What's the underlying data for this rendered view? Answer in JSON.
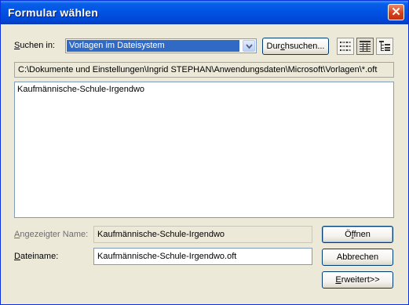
{
  "window": {
    "title": "Formular wählen",
    "close_glyph": "✕"
  },
  "search": {
    "label": "Suchen in:",
    "label_underlined_char": "S",
    "label_rest": "uchen in:",
    "selected": "Vorlagen im Dateisystem",
    "browse_label": "Durchsuchen...",
    "browse_pre": "Dur",
    "browse_underlined_char": "c",
    "browse_post": "hsuchen..."
  },
  "view_buttons": [
    {
      "icon": "list-view-icon",
      "active": false
    },
    {
      "icon": "details-view-icon",
      "active": true
    },
    {
      "icon": "tree-view-icon",
      "active": false
    }
  ],
  "path": "C:\\Dokumente und Einstellungen\\Ingrid STEPHAN\\Anwendungsdaten\\Microsoft\\Vorlagen\\*.oft",
  "list": {
    "items": [
      "Kaufmännische-Schule-Irgendwo"
    ]
  },
  "display_name": {
    "label": "Angezeigter Name:",
    "label_underlined_char": "A",
    "label_rest": "ngezeigter Name:",
    "value": "Kaufmännische-Schule-Irgendwo"
  },
  "file_name": {
    "label": "Dateiname:",
    "label_underlined_char": "D",
    "label_rest": "ateiname:",
    "value": "Kaufmännische-Schule-Irgendwo.oft"
  },
  "buttons": {
    "open": "Öffnen",
    "open_underlined_char": "f",
    "open_pre": "Ö",
    "open_post": "fnen",
    "cancel": "Abbrechen",
    "advanced": "Erweitert>>",
    "advanced_underlined_char": "E",
    "advanced_rest": "rweitert>>"
  },
  "colors": {
    "title_bar": "#0055e5",
    "selection": "#316ac5",
    "dialog_bg": "#ece9d8"
  }
}
